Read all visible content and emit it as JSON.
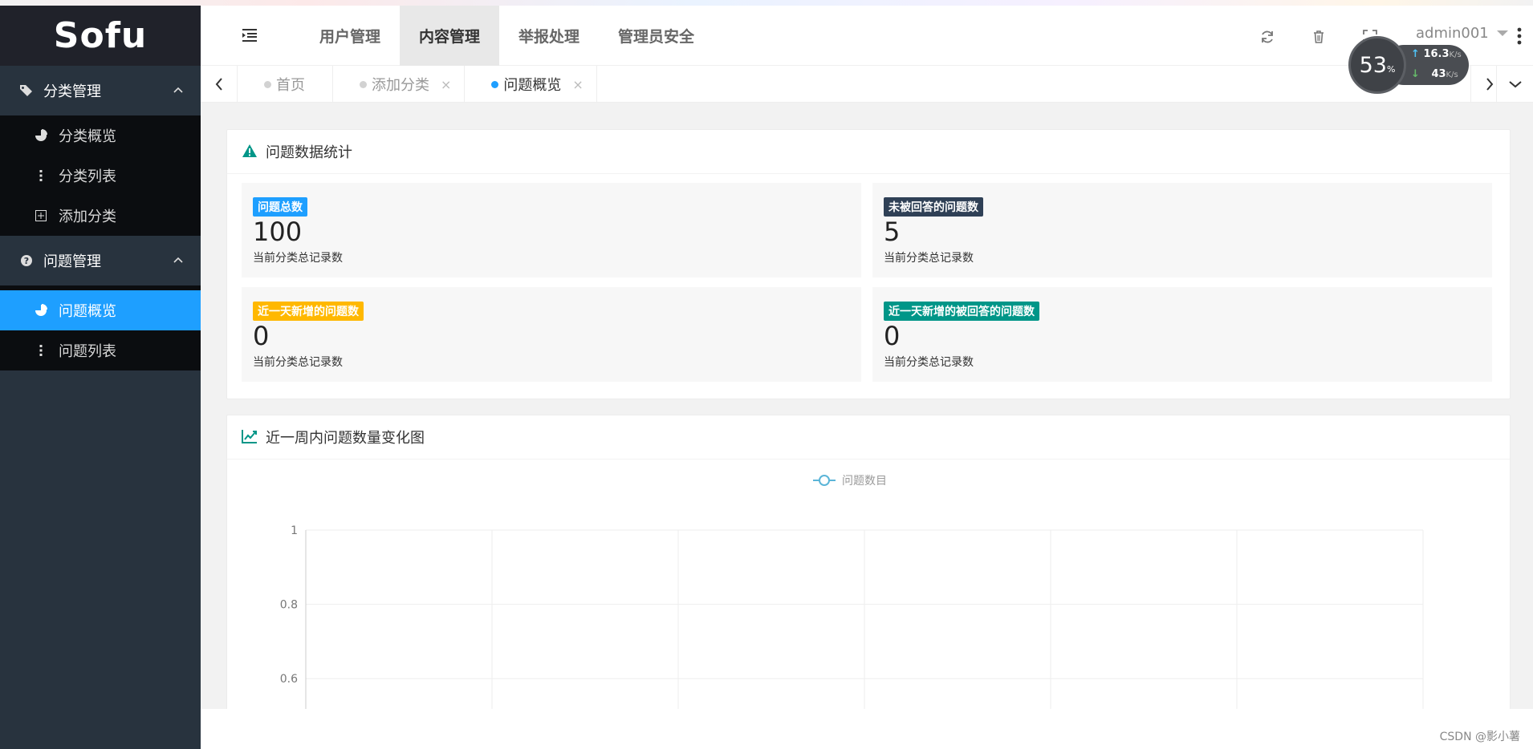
{
  "logo": "Sofu",
  "sidebar": {
    "groups": [
      {
        "label": "分类管理",
        "items": [
          {
            "label": "分类概览"
          },
          {
            "label": "分类列表"
          },
          {
            "label": "添加分类"
          }
        ]
      },
      {
        "label": "问题管理",
        "items": [
          {
            "label": "问题概览"
          },
          {
            "label": "问题列表"
          }
        ]
      }
    ]
  },
  "header": {
    "nav": [
      "用户管理",
      "内容管理",
      "举报处理",
      "管理员安全"
    ],
    "username": "admin001"
  },
  "tabs": [
    {
      "label": "首页"
    },
    {
      "label": "添加分类",
      "close": "×"
    },
    {
      "label": "问题概览",
      "close": "×"
    }
  ],
  "speed": {
    "percent": "53",
    "percent_unit": "%",
    "up": "16.3",
    "down": "43",
    "unit": "K/s"
  },
  "stats_card": {
    "title": "问题数据统计",
    "stats": [
      {
        "badge": "问题总数",
        "badge_color": "#1e9fff",
        "value": "100",
        "desc": "当前分类总记录数"
      },
      {
        "badge": "未被回答的问题数",
        "badge_color": "#2f4056",
        "value": "5",
        "desc": "当前分类总记录数"
      },
      {
        "badge": "近一天新增的问题数",
        "badge_color": "#ffb800",
        "value": "0",
        "desc": "当前分类总记录数"
      },
      {
        "badge": "近一天新增的被回答的问题数",
        "badge_color": "#009688",
        "value": "0",
        "desc": "当前分类总记录数"
      }
    ]
  },
  "chart_card": {
    "title": "近一周内问题数量变化图"
  },
  "chart_data": {
    "type": "line",
    "series": [
      {
        "name": "问题数目",
        "values": []
      }
    ],
    "y_ticks": [
      "1",
      "0.8",
      "0.6"
    ],
    "ylim": [
      0,
      1
    ],
    "x_gridlines": 6,
    "grid": true,
    "legend": "top-center",
    "color": "#5bb5d8"
  },
  "watermark": "CSDN @影小薯"
}
